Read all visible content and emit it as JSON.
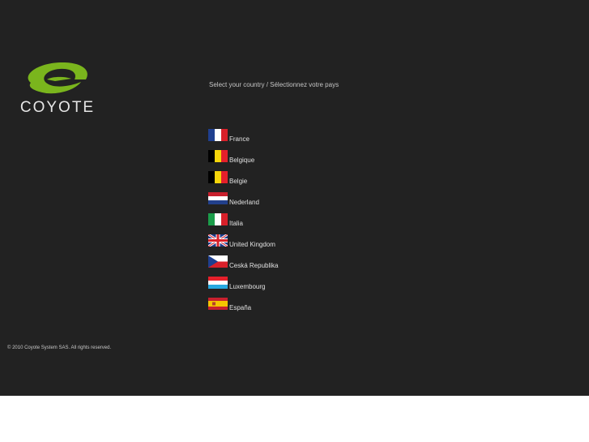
{
  "brand": {
    "name": "COYOTE",
    "logo_green": "#7ab51d",
    "background": "#222222"
  },
  "prompt": "Select your country / Sélectionnez votre pays",
  "countries": [
    {
      "label": "France",
      "flag": "flag-france-icon"
    },
    {
      "label": "Belgique",
      "flag": "flag-belgium-icon"
    },
    {
      "label": "Belgie",
      "flag": "flag-belgium-icon"
    },
    {
      "label": "Nederland",
      "flag": "flag-netherlands-icon"
    },
    {
      "label": "Italia",
      "flag": "flag-italy-icon"
    },
    {
      "label": "United Kingdom",
      "flag": "flag-uk-icon"
    },
    {
      "label": "Ceská Republika",
      "flag": "flag-czech-icon"
    },
    {
      "label": "Luxembourg",
      "flag": "flag-luxembourg-icon"
    },
    {
      "label": "España",
      "flag": "flag-spain-icon"
    }
  ],
  "footer": "© 2010 Coyote System SAS. All rights reserved."
}
